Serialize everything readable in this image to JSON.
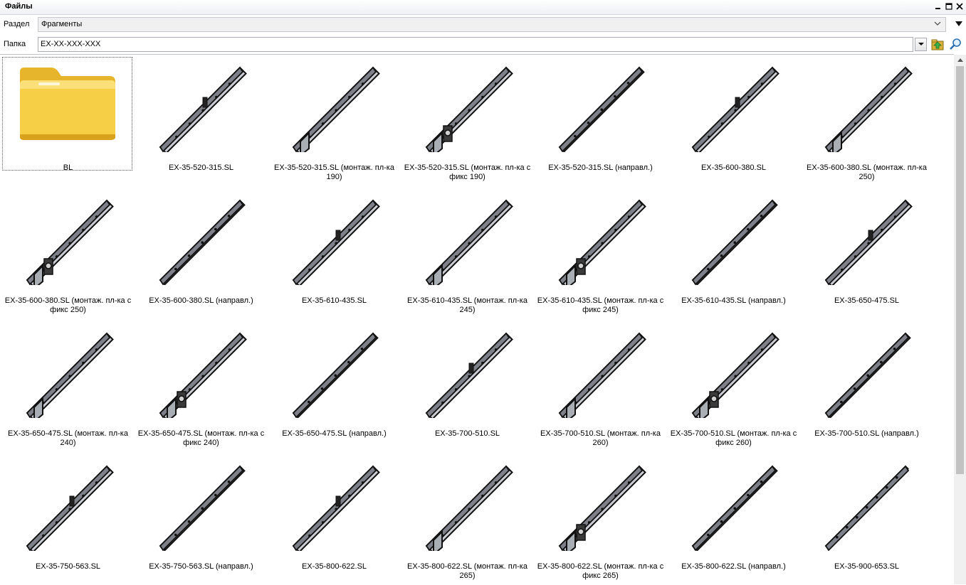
{
  "window": {
    "title": "Файлы",
    "buttons": [
      "minimize",
      "maximize",
      "close"
    ]
  },
  "section": {
    "label": "Раздел",
    "value": "Фрагменты"
  },
  "folder": {
    "label": "Папка",
    "value": "EX-XX-XXX-XXX"
  },
  "items": [
    {
      "name": "BL",
      "kind": "folder"
    },
    {
      "name": "EX-35-520-315.SL",
      "kind": "full"
    },
    {
      "name": "EX-35-520-315.SL (монтаж. пл-ка 190)",
      "kind": "plate"
    },
    {
      "name": "EX-35-520-315.SL (монтаж. пл-ка с фикс 190)",
      "kind": "plate-fix"
    },
    {
      "name": "EX-35-520-315.SL (направл.)",
      "kind": "rail"
    },
    {
      "name": "EX-35-600-380.SL",
      "kind": "full"
    },
    {
      "name": "EX-35-600-380.SL (монтаж. пл-ка 250)",
      "kind": "plate"
    },
    {
      "name": "EX-35-600-380.SL (монтаж. пл-ка с фикс 250)",
      "kind": "plate-fix"
    },
    {
      "name": "EX-35-600-380.SL (направл.)",
      "kind": "rail"
    },
    {
      "name": "EX-35-610-435.SL",
      "kind": "full"
    },
    {
      "name": "EX-35-610-435.SL (монтаж. пл-ка 245)",
      "kind": "plate"
    },
    {
      "name": "EX-35-610-435.SL (монтаж. пл-ка с фикс 245)",
      "kind": "plate-fix"
    },
    {
      "name": "EX-35-610-435.SL (направл.)",
      "kind": "rail"
    },
    {
      "name": "EX-35-650-475.SL",
      "kind": "full"
    },
    {
      "name": "EX-35-650-475.SL (монтаж. пл-ка 240)",
      "kind": "plate"
    },
    {
      "name": "EX-35-650-475.SL (монтаж. пл-ка с фикс 240)",
      "kind": "plate-fix"
    },
    {
      "name": "EX-35-650-475.SL (направл.)",
      "kind": "rail"
    },
    {
      "name": "EX-35-700-510.SL",
      "kind": "full"
    },
    {
      "name": "EX-35-700-510.SL (монтаж. пл-ка 260)",
      "kind": "plate"
    },
    {
      "name": "EX-35-700-510.SL (монтаж. пл-ка с фикс 260)",
      "kind": "plate-fix"
    },
    {
      "name": "EX-35-700-510.SL (направл.)",
      "kind": "rail"
    },
    {
      "name": "EX-35-750-563.SL",
      "kind": "full"
    },
    {
      "name": "EX-35-750-563.SL (направл.)",
      "kind": "rail"
    },
    {
      "name": "EX-35-800-622.SL",
      "kind": "full"
    },
    {
      "name": "EX-35-800-622.SL (монтаж. пл-ка 265)",
      "kind": "plate"
    },
    {
      "name": "EX-35-800-622.SL (монтаж. пл-ка с фикс 265)",
      "kind": "plate-fix"
    },
    {
      "name": "EX-35-800-622.SL (направл.)",
      "kind": "rail"
    },
    {
      "name": "EX-35-900-653.SL",
      "kind": "thin"
    }
  ]
}
